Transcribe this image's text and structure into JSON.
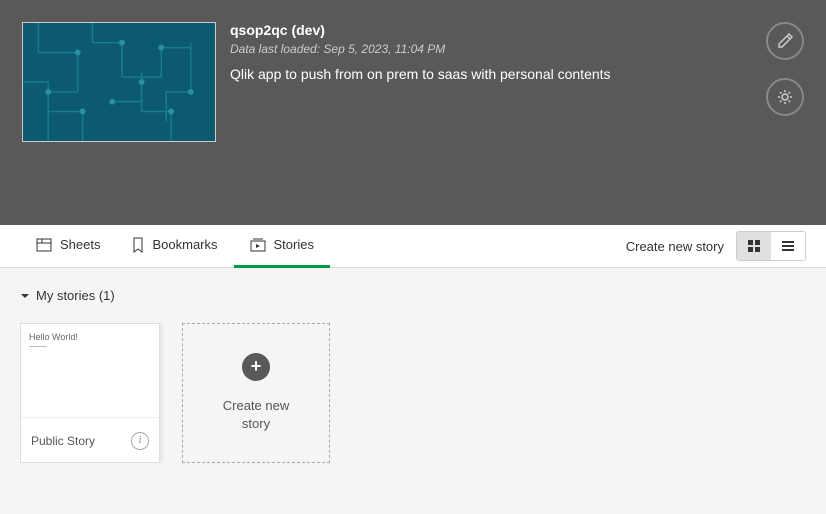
{
  "header": {
    "title": "qsop2qc (dev)",
    "meta": "Data last loaded: Sep 5, 2023, 11:04 PM",
    "description": "Qlik app to push from on prem to saas with personal contents"
  },
  "tabs": {
    "sheets": "Sheets",
    "bookmarks": "Bookmarks",
    "stories": "Stories"
  },
  "actions": {
    "create_story": "Create new story"
  },
  "section": {
    "title": "My stories (1)"
  },
  "story": {
    "preview_text": "Hello World!",
    "preview_sub": "———",
    "title": "Public Story"
  },
  "create_card": {
    "label": "Create new story"
  }
}
